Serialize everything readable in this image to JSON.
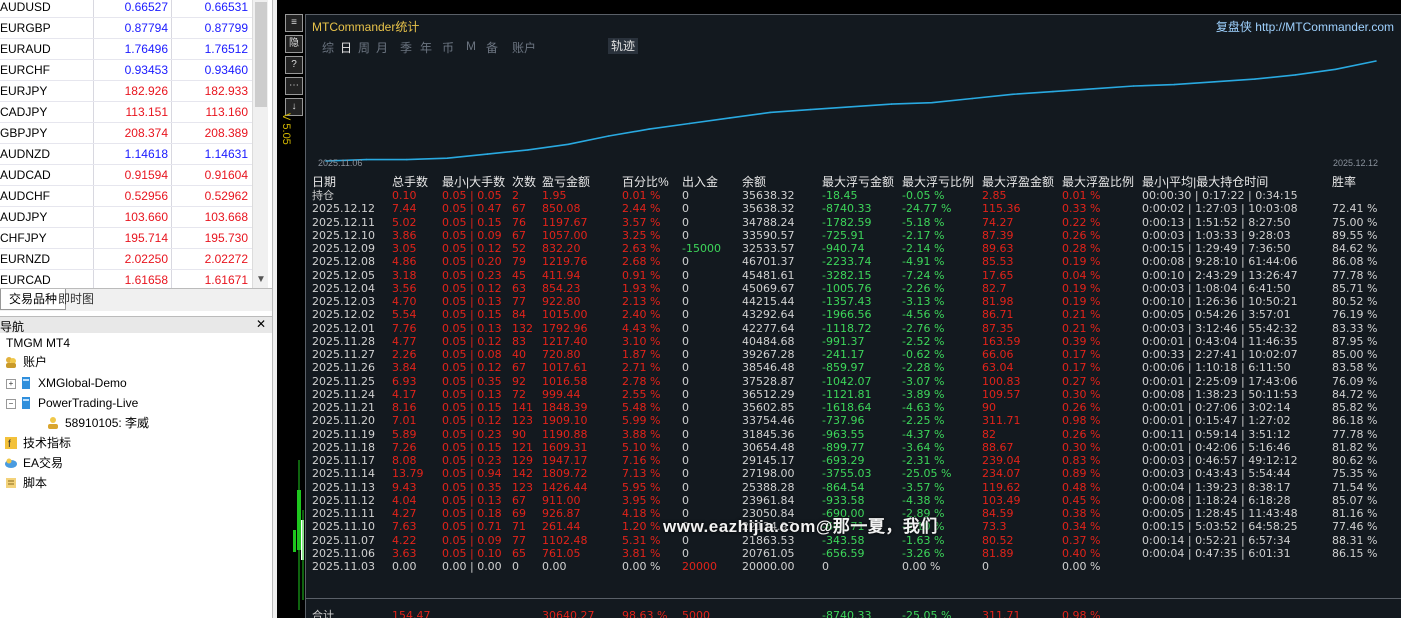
{
  "market_watch": {
    "rows": [
      {
        "symbol": "AUDUSD",
        "bid": "0.66527",
        "ask": "0.66531",
        "color": "#1a1aff"
      },
      {
        "symbol": "EURGBP",
        "bid": "0.87794",
        "ask": "0.87799",
        "color": "#1a1aff"
      },
      {
        "symbol": "EURAUD",
        "bid": "1.76496",
        "ask": "1.76512",
        "color": "#1a1aff"
      },
      {
        "symbol": "EURCHF",
        "bid": "0.93453",
        "ask": "0.93460",
        "color": "#1a1aff"
      },
      {
        "symbol": "EURJPY",
        "bid": "182.926",
        "ask": "182.933",
        "color": "#e8141e"
      },
      {
        "symbol": "CADJPY",
        "bid": "113.151",
        "ask": "113.160",
        "color": "#e8141e"
      },
      {
        "symbol": "GBPJPY",
        "bid": "208.374",
        "ask": "208.389",
        "color": "#e8141e"
      },
      {
        "symbol": "AUDNZD",
        "bid": "1.14618",
        "ask": "1.14631",
        "color": "#1a1aff"
      },
      {
        "symbol": "AUDCAD",
        "bid": "0.91594",
        "ask": "0.91604",
        "color": "#e8141e"
      },
      {
        "symbol": "AUDCHF",
        "bid": "0.52956",
        "ask": "0.52962",
        "color": "#e8141e"
      },
      {
        "symbol": "AUDJPY",
        "bid": "103.660",
        "ask": "103.668",
        "color": "#e8141e"
      },
      {
        "symbol": "CHFJPY",
        "bid": "195.714",
        "ask": "195.730",
        "color": "#e8141e"
      },
      {
        "symbol": "EURNZD",
        "bid": "2.02250",
        "ask": "2.02272",
        "color": "#e8141e"
      },
      {
        "symbol": "EURCAD",
        "bid": "1.61658",
        "ask": "1.61671",
        "color": "#e8141e"
      }
    ],
    "tabs": [
      "交易品种",
      "即时图"
    ]
  },
  "navigator": {
    "title": "导航",
    "items": [
      {
        "label": "TMGM MT4",
        "icon": "terminal-icon"
      },
      {
        "label": "账户",
        "icon": "accounts-icon"
      },
      {
        "label": "XMGlobal-Demo",
        "icon": "server-icon"
      },
      {
        "label": "PowerTrading-Live",
        "icon": "server-icon"
      },
      {
        "label": "58910105: 李威",
        "icon": "user-icon"
      },
      {
        "label": "技术指标",
        "icon": "indicators-icon"
      },
      {
        "label": "EA交易",
        "icon": "expert-icon"
      },
      {
        "label": "脚本",
        "icon": "script-icon"
      }
    ]
  },
  "chart_side": {
    "buttons": [
      "≡",
      "隐",
      "?",
      "⋯",
      "↓"
    ],
    "version": "V 5.05"
  },
  "panel": {
    "title": "MTCommander统计",
    "brand": "复盘侠",
    "url": "http://MTCommander.com",
    "nav": [
      "综",
      "日",
      "周",
      "月",
      "季",
      "年",
      "币",
      "M",
      "备",
      "账户"
    ],
    "nav_selected": "日",
    "track_label": "轨迹",
    "curve_start": "2025.11.06",
    "curve_end": "2025.12.12"
  },
  "table": {
    "headers": [
      "日期",
      "总手数",
      "最小|大手数",
      "次数",
      "盈亏金额",
      "百分比%",
      "出入金",
      "余额",
      "最大浮亏金额",
      "最大浮亏比例",
      "最大浮盈金额",
      "最大浮盈比例",
      "最小|平均|最大持仓时间",
      "胜率"
    ],
    "rows": [
      [
        "持仓",
        "0.10",
        "0.05 | 0.05",
        "2",
        "1.95",
        "0.01 %",
        "0",
        "35638.32",
        "-18.45",
        "-0.05 %",
        "2.85",
        "0.01 %",
        "00:00:30 | 0:17:22 | 0:34:15",
        ""
      ],
      [
        "2025.12.12",
        "7.44",
        "0.05 | 0.47",
        "67",
        "850.08",
        "2.44 %",
        "0",
        "35638.32",
        "-8740.33",
        "-24.77 %",
        "115.36",
        "0.33 %",
        "0:00:02 | 1:27:03 | 10:03:08",
        "72.41 %"
      ],
      [
        "2025.12.11",
        "5.02",
        "0.05 | 0.15",
        "76",
        "1197.67",
        "3.57 %",
        "0",
        "34788.24",
        "-1782.59",
        "-5.18 %",
        "74.27",
        "0.22 %",
        "0:00:13 | 1:51:52 | 8:27:50",
        "75.00 %"
      ],
      [
        "2025.12.10",
        "3.86",
        "0.05 | 0.09",
        "67",
        "1057.00",
        "3.25 %",
        "0",
        "33590.57",
        "-725.91",
        "-2.17 %",
        "87.39",
        "0.26 %",
        "0:00:03 | 1:03:33 | 9:28:03",
        "89.55 %"
      ],
      [
        "2025.12.09",
        "3.05",
        "0.05 | 0.12",
        "52",
        "832.20",
        "2.63 %",
        "-15000",
        "32533.57",
        "-940.74",
        "-2.14 %",
        "89.63",
        "0.28 %",
        "0:00:15 | 1:29:49 | 7:36:50",
        "84.62 %"
      ],
      [
        "2025.12.08",
        "4.86",
        "0.05 | 0.20",
        "79",
        "1219.76",
        "2.68 %",
        "0",
        "46701.37",
        "-2233.74",
        "-4.91 %",
        "85.53",
        "0.19 %",
        "0:00:08 | 9:28:10 | 61:44:06",
        "86.08 %"
      ],
      [
        "2025.12.05",
        "3.18",
        "0.05 | 0.23",
        "45",
        "411.94",
        "0.91 %",
        "0",
        "45481.61",
        "-3282.15",
        "-7.24 %",
        "17.65",
        "0.04 %",
        "0:00:10 | 2:43:29 | 13:26:47",
        "77.78 %"
      ],
      [
        "2025.12.04",
        "3.56",
        "0.05 | 0.12",
        "63",
        "854.23",
        "1.93 %",
        "0",
        "45069.67",
        "-1005.76",
        "-2.26 %",
        "82.7",
        "0.19 %",
        "0:00:03 | 1:08:04 | 6:41:50",
        "85.71 %"
      ],
      [
        "2025.12.03",
        "4.70",
        "0.05 | 0.13",
        "77",
        "922.80",
        "2.13 %",
        "0",
        "44215.44",
        "-1357.43",
        "-3.13 %",
        "81.98",
        "0.19 %",
        "0:00:10 | 1:26:36 | 10:50:21",
        "80.52 %"
      ],
      [
        "2025.12.02",
        "5.54",
        "0.05 | 0.15",
        "84",
        "1015.00",
        "2.40 %",
        "0",
        "43292.64",
        "-1966.56",
        "-4.56 %",
        "86.71",
        "0.21 %",
        "0:00:05 | 0:54:26 | 3:57:01",
        "76.19 %"
      ],
      [
        "2025.12.01",
        "7.76",
        "0.05 | 0.13",
        "132",
        "1792.96",
        "4.43 %",
        "0",
        "42277.64",
        "-1118.72",
        "-2.76 %",
        "87.35",
        "0.21 %",
        "0:00:03 | 3:12:46 | 55:42:32",
        "83.33 %"
      ],
      [
        "2025.11.28",
        "4.77",
        "0.05 | 0.12",
        "83",
        "1217.40",
        "3.10 %",
        "0",
        "40484.68",
        "-991.37",
        "-2.52 %",
        "163.59",
        "0.39 %",
        "0:00:01 | 0:43:04 | 11:46:35",
        "87.95 %"
      ],
      [
        "2025.11.27",
        "2.26",
        "0.05 | 0.08",
        "40",
        "720.80",
        "1.87 %",
        "0",
        "39267.28",
        "-241.17",
        "-0.62 %",
        "66.06",
        "0.17 %",
        "0:00:33 | 2:27:41 | 10:02:07",
        "85.00 %"
      ],
      [
        "2025.11.26",
        "3.84",
        "0.05 | 0.12",
        "67",
        "1017.61",
        "2.71 %",
        "0",
        "38546.48",
        "-859.97",
        "-2.28 %",
        "63.04",
        "0.17 %",
        "0:00:06 | 1:10:18 | 6:11:50",
        "83.58 %"
      ],
      [
        "2025.11.25",
        "6.93",
        "0.05 | 0.35",
        "92",
        "1016.58",
        "2.78 %",
        "0",
        "37528.87",
        "-1042.07",
        "-3.07 %",
        "100.83",
        "0.27 %",
        "0:00:01 | 2:25:09 | 17:43:06",
        "76.09 %"
      ],
      [
        "2025.11.24",
        "4.17",
        "0.05 | 0.13",
        "72",
        "999.44",
        "2.55 %",
        "0",
        "36512.29",
        "-1121.81",
        "-3.89 %",
        "109.57",
        "0.30 %",
        "0:00:08 | 1:38:23 | 50:11:53",
        "84.72 %"
      ],
      [
        "2025.11.21",
        "8.16",
        "0.05 | 0.15",
        "141",
        "1848.39",
        "5.48 %",
        "0",
        "35602.85",
        "-1618.64",
        "-4.63 %",
        "90",
        "0.26 %",
        "0:00:01 | 0:27:06 | 3:02:14",
        "85.82 %"
      ],
      [
        "2025.11.20",
        "7.01",
        "0.05 | 0.12",
        "123",
        "1909.10",
        "5.99 %",
        "0",
        "33754.46",
        "-737.96",
        "-2.25 %",
        "311.71",
        "0.98 %",
        "0:00:01 | 0:15:47 | 1:27:02",
        "86.18 %"
      ],
      [
        "2025.11.19",
        "5.89",
        "0.05 | 0.23",
        "90",
        "1190.88",
        "3.88 %",
        "0",
        "31845.36",
        "-963.55",
        "-4.37 %",
        "82",
        "0.26 %",
        "0:00:11 | 0:59:14 | 3:51:12",
        "77.78 %"
      ],
      [
        "2025.11.18",
        "7.26",
        "0.05 | 0.15",
        "121",
        "1609.31",
        "5.10 %",
        "0",
        "30654.48",
        "-899.77",
        "-3.64 %",
        "88.67",
        "0.30 %",
        "0:00:01 | 0:42:06 | 5:16:46",
        "81.82 %"
      ],
      [
        "2025.11.17",
        "8.08",
        "0.05 | 0.23",
        "129",
        "1947.17",
        "7.16 %",
        "0",
        "29145.17",
        "-693.29",
        "-2.31 %",
        "239.04",
        "0.83 %",
        "0:00:03 | 0:46:57 | 49:12:12",
        "80.62 %"
      ],
      [
        "2025.11.14",
        "13.79",
        "0.05 | 0.94",
        "142",
        "1809.72",
        "7.13 %",
        "0",
        "27198.00",
        "-3755.03",
        "-25.05 %",
        "234.07",
        "0.89 %",
        "0:00:03 | 0:43:43 | 5:54:44",
        "75.35 %"
      ],
      [
        "2025.11.13",
        "9.43",
        "0.05 | 0.35",
        "123",
        "1426.44",
        "5.95 %",
        "0",
        "25388.28",
        "-864.54",
        "-3.57 %",
        "119.62",
        "0.48 %",
        "0:00:04 | 1:39:23 | 8:38:17",
        "71.54 %"
      ],
      [
        "2025.11.12",
        "4.04",
        "0.05 | 0.13",
        "67",
        "911.00",
        "3.95 %",
        "0",
        "23961.84",
        "-933.58",
        "-4.38 %",
        "103.49",
        "0.45 %",
        "0:00:08 | 1:18:24 | 6:18:28",
        "85.07 %"
      ],
      [
        "2025.11.11",
        "4.27",
        "0.05 | 0.18",
        "69",
        "926.87",
        "4.18 %",
        "0",
        "23050.84",
        "-690.00",
        "-2.89 %",
        "84.59",
        "0.38 %",
        "0:00:05 | 1:28:45 | 11:43:48",
        "81.16 %"
      ],
      [
        "2025.11.10",
        "7.63",
        "0.05 | 0.71",
        "71",
        "261.44",
        "1.20 %",
        "0",
        "22124.97",
        "-601.71",
        "-2.10 %",
        "73.3",
        "0.34 %",
        "0:00:15 | 5:03:52 | 64:58:25",
        "77.46 %"
      ],
      [
        "2025.11.07",
        "4.22",
        "0.05 | 0.09",
        "77",
        "1102.48",
        "5.31 %",
        "0",
        "21863.53",
        "-343.58",
        "-1.63 %",
        "80.52",
        "0.37 %",
        "0:00:14 | 0:52:21 | 6:57:34",
        "88.31 %"
      ],
      [
        "2025.11.06",
        "3.63",
        "0.05 | 0.10",
        "65",
        "761.05",
        "3.81 %",
        "0",
        "20761.05",
        "-656.59",
        "-3.26 %",
        "81.89",
        "0.40 %",
        "0:00:04 | 0:47:35 | 6:01:31",
        "86.15 %"
      ],
      [
        "2025.11.03",
        "0.00",
        "0.00 | 0.00",
        "0",
        "0.00",
        "0.00 %",
        "20000",
        "20000.00",
        "0",
        "0.00 %",
        "0",
        "0.00 %",
        "",
        ""
      ]
    ],
    "total": [
      "合计",
      "154.47",
      "",
      "",
      "30640.27",
      "98.63 %",
      "5000",
      "",
      "-8740.33",
      "-25.05 %",
      "311.71",
      "0.98 %",
      "",
      ""
    ]
  },
  "watermark": "www.eazhijia.com@那一夏，我们",
  "chart_data": {
    "type": "line",
    "x": [
      "2025.11.06",
      "2025.11.07",
      "2025.11.10",
      "2025.11.11",
      "2025.11.12",
      "2025.11.13",
      "2025.11.14",
      "2025.11.17",
      "2025.11.18",
      "2025.11.19",
      "2025.11.20",
      "2025.11.21",
      "2025.11.24",
      "2025.11.25",
      "2025.11.26",
      "2025.11.27",
      "2025.11.28",
      "2025.12.01",
      "2025.12.02",
      "2025.12.03",
      "2025.12.04",
      "2025.12.05",
      "2025.12.08",
      "2025.12.09",
      "2025.12.10",
      "2025.12.11",
      "2025.12.12"
    ],
    "series": [
      {
        "values": [
          0,
          1,
          1,
          2,
          5,
          8,
          12,
          18,
          23,
          27,
          31,
          35,
          37,
          39,
          41,
          42,
          45,
          48,
          50,
          52,
          54,
          55,
          57,
          59,
          62,
          66,
          72
        ]
      }
    ],
    "color": "#29a9e0"
  }
}
